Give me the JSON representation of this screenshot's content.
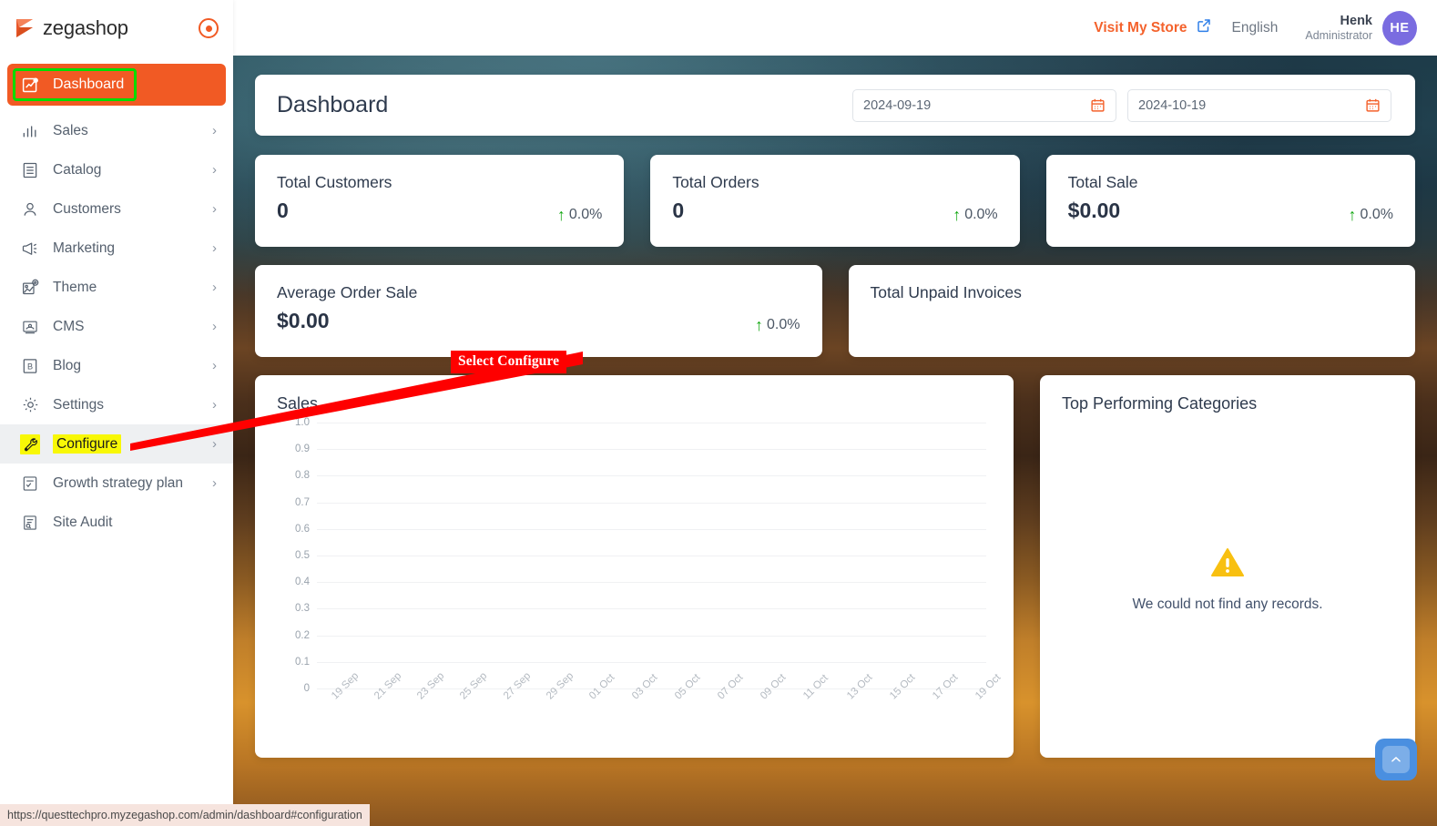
{
  "brand": {
    "name": "zegashop",
    "logo_icon": "zegashop-logo",
    "collapse_icon": "collapse-toggle-icon"
  },
  "sidebar": {
    "items": [
      {
        "label": "Dashboard",
        "icon": "dashboard-icon",
        "active": true,
        "chevron": ""
      },
      {
        "label": "Sales",
        "icon": "bar-chart-icon",
        "chevron": "›"
      },
      {
        "label": "Catalog",
        "icon": "catalog-list-icon",
        "chevron": "›"
      },
      {
        "label": "Customers",
        "icon": "user-icon",
        "chevron": "›"
      },
      {
        "label": "Marketing",
        "icon": "megaphone-icon",
        "chevron": "›"
      },
      {
        "label": "Theme",
        "icon": "theme-image-gear-icon",
        "chevron": "›"
      },
      {
        "label": "CMS",
        "icon": "cms-icon",
        "chevron": "›"
      },
      {
        "label": "Blog",
        "icon": "blog-b-icon",
        "chevron": "›"
      },
      {
        "label": "Settings",
        "icon": "gear-icon",
        "chevron": "›"
      },
      {
        "label": "Configure",
        "icon": "wrench-icon",
        "chevron": "›",
        "highlighted": true
      },
      {
        "label": "Growth strategy plan",
        "icon": "checklist-icon",
        "chevron": "›"
      },
      {
        "label": "Site Audit",
        "icon": "document-search-icon",
        "chevron": ""
      }
    ]
  },
  "topbar": {
    "visit_store_label": "Visit My Store",
    "visit_store_icon": "external-link-icon",
    "language": "English",
    "user_name": "Henk",
    "user_role": "Administrator",
    "avatar_initials": "HE"
  },
  "header": {
    "title": "Dashboard",
    "date_from": "2024-09-19",
    "date_to": "2024-10-19",
    "calendar_icon": "calendar-icon"
  },
  "stats": [
    {
      "title": "Total Customers",
      "value": "0",
      "delta": "0.0%",
      "trend": "up"
    },
    {
      "title": "Total Orders",
      "value": "0",
      "delta": "0.0%",
      "trend": "up"
    },
    {
      "title": "Total Sale",
      "value": "$0.00",
      "delta": "0.0%",
      "trend": "up"
    }
  ],
  "stats_row2": [
    {
      "title": "Average Order Sale",
      "value": "$0.00",
      "delta": "0.0%",
      "trend": "up",
      "has_value": true
    },
    {
      "title": "Total Unpaid Invoices",
      "value": "",
      "delta": "",
      "trend": "",
      "has_value": false
    }
  ],
  "categories_panel": {
    "title": "Top Performing Categories",
    "empty_message": "We could not find any records.",
    "empty_icon": "warning-triangle-icon"
  },
  "annotation": {
    "label": "Select Configure",
    "color": "#fe0000"
  },
  "scroll_top": {
    "icon": "chevron-up-icon"
  },
  "statusbar": {
    "url": "https://questtechpro.myzegashop.com/admin/dashboard#configuration"
  },
  "colors": {
    "brand_orange": "#f15a24",
    "highlight_yellow": "#f8f806",
    "active_outline_green": "#00dd00",
    "trend_up_green": "#16a815",
    "avatar_purple": "#7a6ce0",
    "scroll_top_blue": "#4a8fe0",
    "annotation_red": "#fe0000"
  },
  "chart_data": {
    "type": "line",
    "title": "Sales",
    "xlabel": "",
    "ylabel": "",
    "ylim": [
      0,
      1.0
    ],
    "grid": true,
    "legend": "none",
    "yticks": [
      "1.0",
      "0.9",
      "0.8",
      "0.7",
      "0.6",
      "0.5",
      "0.4",
      "0.3",
      "0.2",
      "0.1",
      "0"
    ],
    "categories": [
      "19 Sep",
      "21 Sep",
      "23 Sep",
      "25 Sep",
      "27 Sep",
      "29 Sep",
      "01 Oct",
      "03 Oct",
      "05 Oct",
      "07 Oct",
      "09 Oct",
      "11 Oct",
      "13 Oct",
      "15 Oct",
      "17 Oct",
      "19 Oct"
    ],
    "series": [
      {
        "name": "Sales",
        "values": [
          0,
          0,
          0,
          0,
          0,
          0,
          0,
          0,
          0,
          0,
          0,
          0,
          0,
          0,
          0,
          0
        ]
      }
    ]
  }
}
